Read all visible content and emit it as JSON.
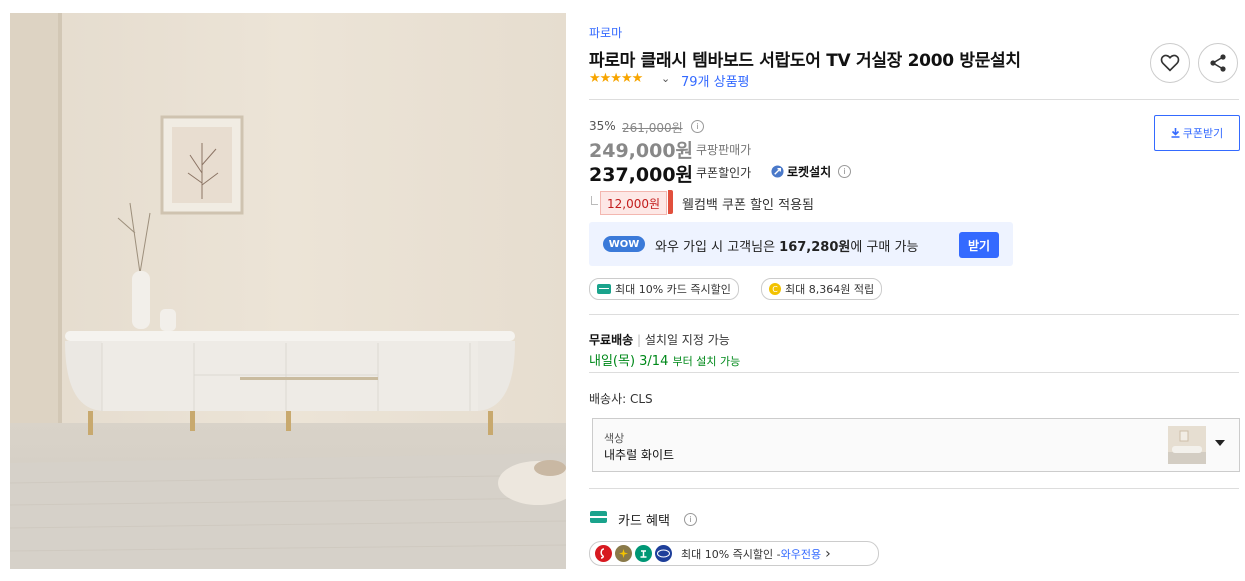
{
  "product": {
    "brand": "파로마",
    "title": "파로마 클래시 템바보드 서랍도어 TV 거실장 2000 방문설치",
    "rating_stars": "★★★★★",
    "rating_value": 4.5,
    "review_count": "79개 상품평"
  },
  "price": {
    "discount_rate": "35%",
    "original_price": "261,000원",
    "sale_price": "249,000원",
    "sale_label": "쿠팡판매가",
    "coupon_price": "237,000원",
    "coupon_label": "쿠폰할인가",
    "rocket_label": "로켓설치",
    "coupon_button": "쿠폰받기"
  },
  "welcome": {
    "amount": "12,000원",
    "text": "웰컴백 쿠폰 할인 적용됨"
  },
  "wow": {
    "badge": "WOW",
    "text_before": "와우 가입 시 고객님은 ",
    "amount": "167,280원",
    "text_after": "에 구매 가능",
    "button": "받기"
  },
  "benefit_pills": {
    "card": "최대 10% 카드 즉시할인",
    "coin_symbol": "C",
    "points": "최대 8,364원 적립"
  },
  "shipping": {
    "free_label": "무료배송",
    "divider": "|",
    "install_note": "설치일 지정 가능",
    "arrival_main": "내일(목) 3/14",
    "arrival_suffix": "부터 설치 가능",
    "carrier": "배송사: CLS"
  },
  "option": {
    "label": "색상",
    "value": "내추럴 화이트"
  },
  "card_benefit": {
    "title": "카드 혜택",
    "info": "i",
    "detail": "최대 10% 즉시할인 - ",
    "wow_only": "와우전용",
    "chevron": "›"
  },
  "icons": {
    "heart": "heart-icon",
    "share": "share-icon",
    "info": "i",
    "chevron_down": "⌄",
    "download": "download-icon",
    "rocket": "rocket-icon",
    "dropdown": "caret-down-icon"
  },
  "colors": {
    "accent_blue": "#346aff",
    "green": "#00891a",
    "star": "#f7a500",
    "wow_bg": "#eef3ff",
    "coupon_red": "#c31d1d"
  }
}
